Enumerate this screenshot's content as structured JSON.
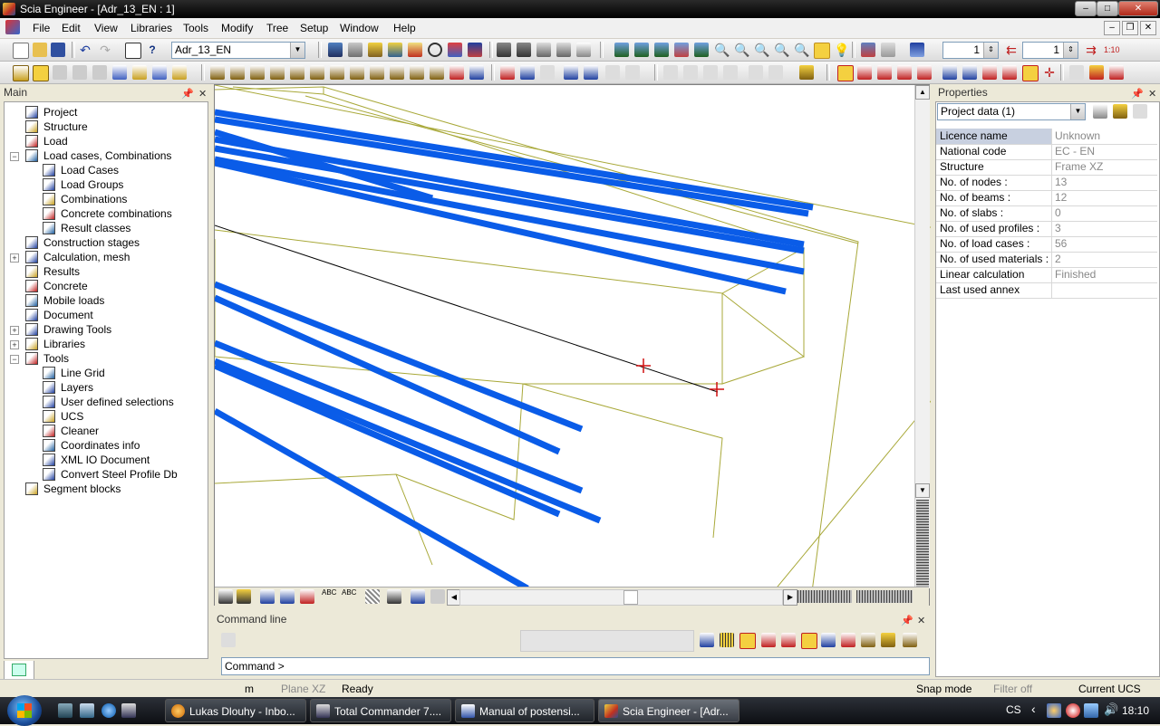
{
  "window": {
    "title": "Scia Engineer - [Adr_13_EN : 1]"
  },
  "menu": [
    "File",
    "Edit",
    "View",
    "Libraries",
    "Tools",
    "Modify",
    "Tree",
    "Setup",
    "Window",
    "Help"
  ],
  "toolbar": {
    "project_combo": "Adr_13_EN",
    "spin1": "1",
    "spin2": "1"
  },
  "main_panel": {
    "title": "Main",
    "tree": [
      {
        "label": "Project",
        "level": 0,
        "expander": "",
        "icon": "project-icon"
      },
      {
        "label": "Structure",
        "level": 0,
        "expander": "",
        "icon": "structure-icon"
      },
      {
        "label": "Load",
        "level": 0,
        "expander": "",
        "icon": "load-icon"
      },
      {
        "label": "Load cases, Combinations",
        "level": 0,
        "expander": "−",
        "icon": "load-cases-icon"
      },
      {
        "label": "Load Cases",
        "level": 1,
        "expander": "",
        "icon": "load-case-icon"
      },
      {
        "label": "Load Groups",
        "level": 1,
        "expander": "",
        "icon": "load-group-icon"
      },
      {
        "label": "Combinations",
        "level": 1,
        "expander": "",
        "icon": "combination-icon"
      },
      {
        "label": "Concrete combinations",
        "level": 1,
        "expander": "",
        "icon": "concrete-combination-icon"
      },
      {
        "label": "Result classes",
        "level": 1,
        "expander": "",
        "icon": "result-class-icon"
      },
      {
        "label": "Construction stages",
        "level": 0,
        "expander": "",
        "icon": "construction-stage-icon"
      },
      {
        "label": "Calculation, mesh",
        "level": 0,
        "expander": "+",
        "icon": "calculation-icon"
      },
      {
        "label": "Results",
        "level": 0,
        "expander": "",
        "icon": "results-icon"
      },
      {
        "label": "Concrete",
        "level": 0,
        "expander": "",
        "icon": "concrete-icon"
      },
      {
        "label": "Mobile loads",
        "level": 0,
        "expander": "",
        "icon": "mobile-load-icon"
      },
      {
        "label": "Document",
        "level": 0,
        "expander": "",
        "icon": "document-icon"
      },
      {
        "label": "Drawing Tools",
        "level": 0,
        "expander": "+",
        "icon": "drawing-tools-icon"
      },
      {
        "label": "Libraries",
        "level": 0,
        "expander": "+",
        "icon": "libraries-icon"
      },
      {
        "label": "Tools",
        "level": 0,
        "expander": "−",
        "icon": "tools-icon"
      },
      {
        "label": "Line Grid",
        "level": 1,
        "expander": "",
        "icon": "line-grid-icon"
      },
      {
        "label": "Layers",
        "level": 1,
        "expander": "",
        "icon": "layers-icon"
      },
      {
        "label": "User defined selections",
        "level": 1,
        "expander": "",
        "icon": "selection-icon"
      },
      {
        "label": "UCS",
        "level": 1,
        "expander": "",
        "icon": "ucs-icon"
      },
      {
        "label": "Cleaner",
        "level": 1,
        "expander": "",
        "icon": "cleaner-icon"
      },
      {
        "label": "Coordinates info",
        "level": 1,
        "expander": "",
        "icon": "coordinates-icon"
      },
      {
        "label": "XML IO Document",
        "level": 1,
        "expander": "",
        "icon": "xml-icon"
      },
      {
        "label": "Convert Steel Profile Db",
        "level": 1,
        "expander": "",
        "icon": "convert-icon"
      },
      {
        "label": "Segment blocks",
        "level": 0,
        "expander": "",
        "icon": "segment-blocks-icon"
      }
    ]
  },
  "properties": {
    "title": "Properties",
    "selector": "Project data (1)",
    "rows": [
      {
        "key": "Licence name",
        "value": "Unknown"
      },
      {
        "key": "National code",
        "value": "EC - EN"
      },
      {
        "key": "Structure",
        "value": "Frame XZ"
      },
      {
        "key": "No. of nodes :",
        "value": "13"
      },
      {
        "key": "No. of beams :",
        "value": "12"
      },
      {
        "key": "No. of slabs :",
        "value": "0"
      },
      {
        "key": "No. of used profiles :",
        "value": "3"
      },
      {
        "key": "No. of load cases :",
        "value": "56"
      },
      {
        "key": "No. of used materials :",
        "value": "2"
      },
      {
        "key": "Linear calculation",
        "value": "Finished"
      },
      {
        "key": "Last used annex",
        "value": ""
      }
    ]
  },
  "command_line": {
    "title": "Command line",
    "prompt": "Command >"
  },
  "status": {
    "unit": "m",
    "plane": "Plane XZ",
    "state": "Ready",
    "snap": "Snap mode",
    "filter": "Filter off",
    "ucs": "Current UCS"
  },
  "taskbar": {
    "tasks": [
      {
        "label": "Lukas Dlouhy - Inbo...",
        "icon": "thunderbird-icon"
      },
      {
        "label": "Total Commander 7....",
        "icon": "total-commander-icon"
      },
      {
        "label": "Manual of postensi...",
        "icon": "document-window-icon"
      },
      {
        "label": "Scia Engineer - [Adr...",
        "icon": "scia-icon"
      }
    ],
    "lang": "CS",
    "clock": "18:10"
  },
  "colors": {
    "tendon": "#0a5ce8",
    "wire": "#a8a838",
    "titlebar": "#000000",
    "marker": "#d01010"
  }
}
